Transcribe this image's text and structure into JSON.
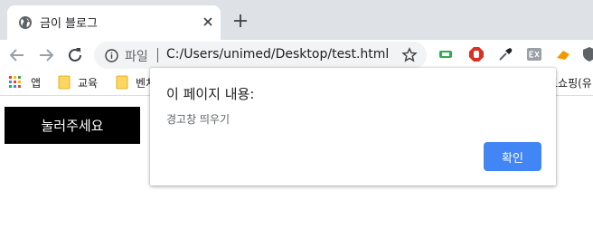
{
  "tab": {
    "title": "금이 블로그"
  },
  "omnibox": {
    "scheme_label": "파일",
    "url": "C:/Users/unimed/Desktop/test.html"
  },
  "bookmarks": [
    {
      "label": "앱",
      "icon": "apps-grid-icon"
    },
    {
      "label": "교육",
      "icon": "folder-icon"
    },
    {
      "label": "벤처",
      "icon": "folder-icon"
    },
    {
      "label": "드쇼핑(유",
      "icon": ""
    }
  ],
  "extensions": [
    "tag-icon",
    "stop-hand-icon",
    "eyedropper-icon",
    "ex-extension-icon",
    "orange-arrow-icon",
    "shield-icon"
  ],
  "page": {
    "button_label": "눌러주세요"
  },
  "dialog": {
    "title": "이 페이지 내용:",
    "message": "경고창 띄우기",
    "ok_label": "확인",
    "ok_color": "#4285f4"
  }
}
